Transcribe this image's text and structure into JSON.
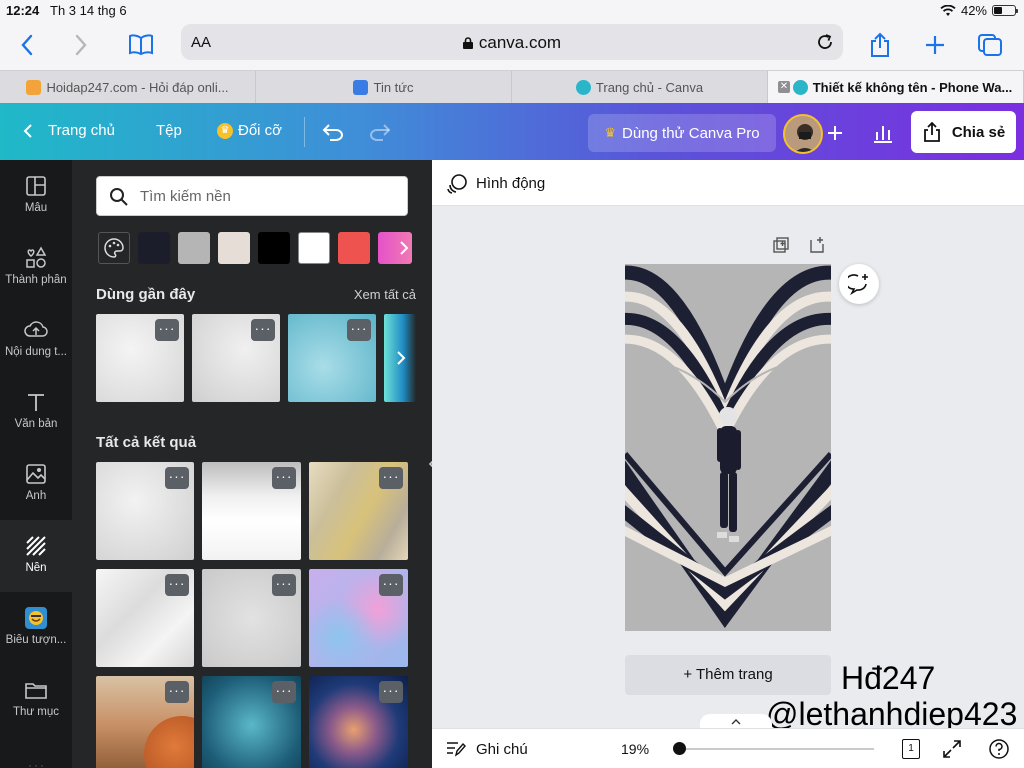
{
  "status": {
    "time": "12:24",
    "date": "Th 3 14 thg 6",
    "battery": "42%",
    "battery_level": 0.42
  },
  "safari": {
    "text_size": "AA",
    "url": "canva.com"
  },
  "tabs": [
    {
      "title": "Hoidap247.com - Hỏi đáp onli...",
      "fav_color": "#f2a33a"
    },
    {
      "title": "Tin tức",
      "fav_color": "#3b7be6"
    },
    {
      "title": "Trang chủ - Canva",
      "fav_color": "#2bb5c9"
    },
    {
      "title": "Thiết kế không tên - Phone Wa...",
      "fav_color": "#2bb5c9"
    }
  ],
  "header": {
    "home": "Trang chủ",
    "file": "Tệp",
    "resize": "Đổi cỡ",
    "pro": "Dùng thử Canva Pro",
    "share": "Chia sẻ"
  },
  "rail": [
    {
      "label": "Mẫu",
      "icon": "template-icon"
    },
    {
      "label": "Thành phần",
      "icon": "elements-icon"
    },
    {
      "label": "Nội dung t...",
      "icon": "upload-icon"
    },
    {
      "label": "Văn bản",
      "icon": "text-icon"
    },
    {
      "label": "Ảnh",
      "icon": "photo-icon"
    },
    {
      "label": "Nền",
      "icon": "background-icon"
    },
    {
      "label": "Biểu tượn...",
      "icon": "emoji-icon"
    },
    {
      "label": "Thư mục",
      "icon": "folder-icon"
    }
  ],
  "panel": {
    "search_placeholder": "Tìm kiếm nền",
    "swatches": [
      "#1c1d2b",
      "#b5b5b5",
      "#e6ddd6",
      "#000000",
      "#ffffff",
      "#ef5350"
    ],
    "recent_title": "Dùng gần đây",
    "see_all": "Xem tất cả",
    "all_results": "Tất cả kết quả"
  },
  "canvas": {
    "animation": "Hình động",
    "add_page": "+ Thêm trang",
    "design_bg": "#b5b5b5"
  },
  "bottom": {
    "notes": "Ghi chú",
    "zoom": "19%",
    "zoom_level": 0.19,
    "page": "1"
  },
  "watermark": {
    "line1": "Hđ247",
    "line2": "@lethanhdiep423"
  }
}
